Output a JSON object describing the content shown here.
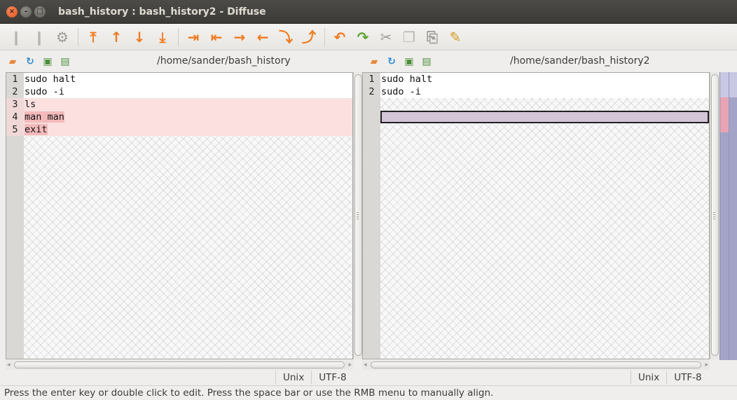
{
  "window": {
    "title": "bash_history : bash_history2 - Diffuse"
  },
  "toolbar": {
    "buttons": [
      {
        "name": "realign-all-icon",
        "glyph": "❙"
      },
      {
        "name": "isolate-icon",
        "glyph": "❙"
      },
      {
        "name": "merge-settings-icon",
        "glyph": "⚙"
      },
      {
        "name": "first-difference-icon",
        "glyph": "⤒"
      },
      {
        "name": "previous-difference-icon",
        "glyph": "↑"
      },
      {
        "name": "next-difference-icon",
        "glyph": "↓"
      },
      {
        "name": "last-difference-icon",
        "glyph": "⤓"
      },
      {
        "name": "copy-selection-right-icon",
        "glyph": "⇥"
      },
      {
        "name": "copy-selection-left-icon",
        "glyph": "⇤"
      },
      {
        "name": "copy-right-icon",
        "glyph": "→"
      },
      {
        "name": "copy-left-icon",
        "glyph": "←"
      },
      {
        "name": "merge-from-left-icon",
        "glyph": "⤵"
      },
      {
        "name": "merge-from-right-icon",
        "glyph": "⤴"
      },
      {
        "name": "undo-icon",
        "glyph": "↶"
      },
      {
        "name": "redo-icon",
        "glyph": "↷"
      },
      {
        "name": "cut-icon",
        "glyph": "✂"
      },
      {
        "name": "copy-icon",
        "glyph": "❐"
      },
      {
        "name": "paste-icon",
        "glyph": "⎘"
      },
      {
        "name": "clear-edits-icon",
        "glyph": "✎"
      }
    ]
  },
  "left_pane": {
    "path": "/home/sander/bash_history",
    "lines": [
      {
        "num": "1",
        "text": "sudo halt",
        "state": "same"
      },
      {
        "num": "2",
        "text": "sudo -i",
        "state": "same"
      },
      {
        "num": "3",
        "text": "ls",
        "state": "diff"
      },
      {
        "num": "4",
        "text": "man man",
        "state": "diff"
      },
      {
        "num": "5",
        "text": "exit",
        "state": "diff"
      }
    ],
    "format": "Unix",
    "encoding": "UTF-8"
  },
  "right_pane": {
    "path": "/home/sander/bash_history2",
    "lines": [
      {
        "num": "1",
        "text": "sudo halt",
        "state": "same"
      },
      {
        "num": "2",
        "text": "sudo -i",
        "state": "same"
      },
      {
        "num": "",
        "text": "",
        "state": "hatch"
      },
      {
        "num": "",
        "text": "",
        "state": "cursor"
      },
      {
        "num": "",
        "text": "",
        "state": "hatch"
      }
    ],
    "format": "Unix",
    "encoding": "UTF-8"
  },
  "colors": {
    "diff_bg": "#fce0e0",
    "cursor_bg": "#d3c4d6",
    "accent": "#f07a1e"
  },
  "status": {
    "message": "Press the enter key or double click to edit.  Press the space bar or use the RMB menu to manually align."
  }
}
